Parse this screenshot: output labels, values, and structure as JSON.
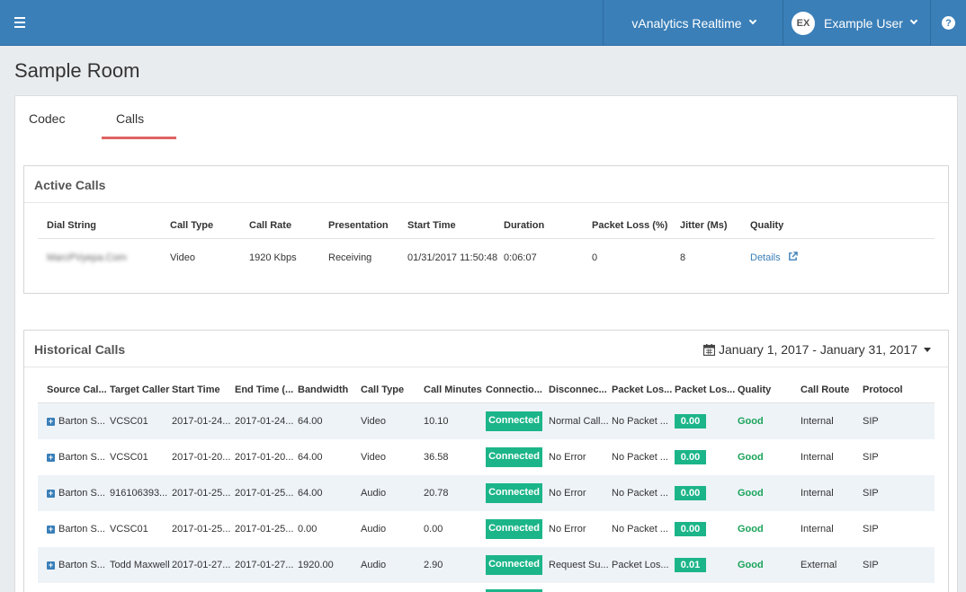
{
  "topbar": {
    "app_name": "vAnalytics Realtime",
    "user_initials": "EX",
    "user_name": "Example User",
    "help_glyph": "?"
  },
  "page": {
    "title": "Sample Room"
  },
  "tabs": [
    {
      "label": "Codec",
      "active": false
    },
    {
      "label": "Calls",
      "active": true
    }
  ],
  "active_calls": {
    "title": "Active Calls",
    "columns": [
      "Dial String",
      "Call Type",
      "Call Rate",
      "Presentation",
      "Start Time",
      "Duration",
      "Packet Loss (%)",
      "Jitter (Ms)",
      "Quality"
    ],
    "rows": [
      [
        "MarcPVyepa.Com",
        "Video",
        "1920 Kbps",
        "Receiving",
        "01/31/2017 11:50:48",
        "0:06:07",
        "0",
        "8",
        "Details"
      ]
    ]
  },
  "historical_calls": {
    "title": "Historical Calls",
    "date_range": "January 1, 2017 - January 31, 2017",
    "columns": [
      "Source Cal...",
      "Target Caller",
      "Start Time",
      "End Time (...",
      "Bandwidth",
      "Call Type",
      "Call Minutes",
      "Connectio...",
      "Disconnec...",
      "Packet Los...",
      "Packet Los...",
      "Quality",
      "Call Route",
      "Protocol"
    ],
    "rows": [
      [
        "Barton S...",
        "VCSC01",
        "2017-01-24...",
        "2017-01-24...",
        "64.00",
        "Video",
        "10.10",
        "Connected",
        "Normal Call...",
        "No Packet ...",
        "0.00",
        "Good",
        "Internal",
        "SIP"
      ],
      [
        "Barton S...",
        "VCSC01",
        "2017-01-20...",
        "2017-01-20...",
        "64.00",
        "Video",
        "36.58",
        "Connected",
        "No Error",
        "No Packet ...",
        "0.00",
        "Good",
        "Internal",
        "SIP"
      ],
      [
        "Barton S...",
        "916106393...",
        "2017-01-25...",
        "2017-01-25...",
        "64.00",
        "Audio",
        "20.78",
        "Connected",
        "No Error",
        "No Packet ...",
        "0.00",
        "Good",
        "Internal",
        "SIP"
      ],
      [
        "Barton S...",
        "VCSC01",
        "2017-01-25...",
        "2017-01-25...",
        "0.00",
        "Audio",
        "0.00",
        "Connected",
        "No Error",
        "No Packet ...",
        "0.00",
        "Good",
        "Internal",
        "SIP"
      ],
      [
        "Barton S...",
        "Todd Maxwell",
        "2017-01-27...",
        "2017-01-27...",
        "1920.00",
        "Audio",
        "2.90",
        "Connected",
        "Request Su...",
        "Packet Los...",
        "0.01",
        "Good",
        "External",
        "SIP"
      ]
    ]
  },
  "colors": {
    "accent": "#3a7fb8",
    "success": "#1cb589",
    "good": "#1aa35a",
    "tab_underline": "#e06363"
  }
}
